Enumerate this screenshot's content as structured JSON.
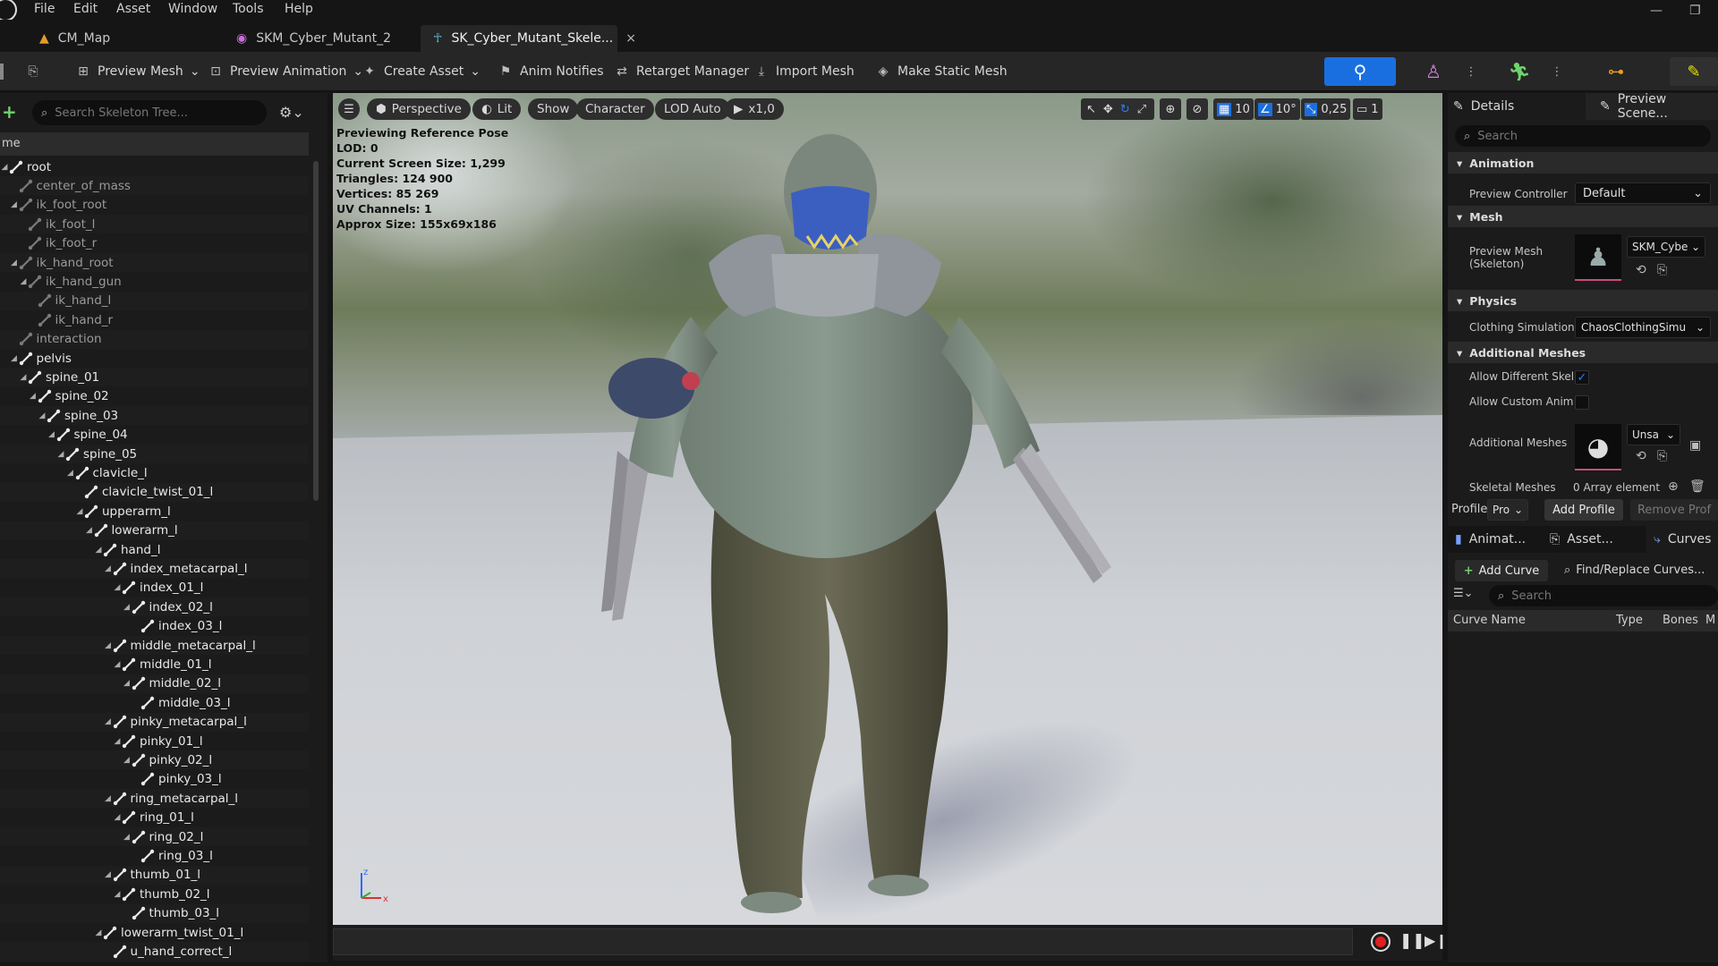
{
  "menu": [
    "File",
    "Edit",
    "Asset",
    "Window",
    "Tools",
    "Help"
  ],
  "tabs": [
    {
      "label": "CM_Map",
      "active": false,
      "icon": "level-icon"
    },
    {
      "label": "SKM_Cyber_Mutant_2",
      "active": false,
      "icon": "skeletal-mesh-icon"
    },
    {
      "label": "SK_Cyber_Mutant_Skele...",
      "active": true,
      "icon": "skeleton-icon",
      "close": "×"
    }
  ],
  "toolbar": {
    "preview_mesh": "Preview Mesh",
    "preview_animation": "Preview Animation",
    "create_asset": "Create Asset",
    "anim_notifies": "Anim Notifies",
    "retarget_manager": "Retarget Manager",
    "import_mesh": "Import Mesh",
    "make_static_mesh": "Make Static Mesh",
    "modes": [
      "skeleton-mode",
      "mesh-mode",
      "animation-mode",
      "physics-mode",
      "blueprint-mode"
    ]
  },
  "skeleton_tree": {
    "search_placeholder": "Search Skeleton Tree...",
    "column_header": "me",
    "bones": [
      {
        "name": "root",
        "depth": 0,
        "expanded": true,
        "virtual": false
      },
      {
        "name": "center_of_mass",
        "depth": 1,
        "virtual": true
      },
      {
        "name": "ik_foot_root",
        "depth": 1,
        "expanded": true,
        "virtual": true
      },
      {
        "name": "ik_foot_l",
        "depth": 2,
        "virtual": true
      },
      {
        "name": "ik_foot_r",
        "depth": 2,
        "virtual": true
      },
      {
        "name": "ik_hand_root",
        "depth": 1,
        "expanded": true,
        "virtual": true
      },
      {
        "name": "ik_hand_gun",
        "depth": 2,
        "expanded": true,
        "virtual": true
      },
      {
        "name": "ik_hand_l",
        "depth": 3,
        "virtual": true
      },
      {
        "name": "ik_hand_r",
        "depth": 3,
        "virtual": true
      },
      {
        "name": "interaction",
        "depth": 1,
        "virtual": true
      },
      {
        "name": "pelvis",
        "depth": 1,
        "expanded": true,
        "virtual": false
      },
      {
        "name": "spine_01",
        "depth": 2,
        "expanded": true,
        "virtual": false
      },
      {
        "name": "spine_02",
        "depth": 3,
        "expanded": true,
        "virtual": false
      },
      {
        "name": "spine_03",
        "depth": 4,
        "expanded": true,
        "virtual": false
      },
      {
        "name": "spine_04",
        "depth": 5,
        "expanded": true,
        "virtual": false
      },
      {
        "name": "spine_05",
        "depth": 6,
        "expanded": true,
        "virtual": false
      },
      {
        "name": "clavicle_l",
        "depth": 7,
        "expanded": true,
        "virtual": false
      },
      {
        "name": "clavicle_twist_01_l",
        "depth": 8,
        "virtual": false
      },
      {
        "name": "upperarm_l",
        "depth": 8,
        "expanded": true,
        "virtual": false
      },
      {
        "name": "lowerarm_l",
        "depth": 9,
        "expanded": true,
        "virtual": false
      },
      {
        "name": "hand_l",
        "depth": 10,
        "expanded": true,
        "virtual": false
      },
      {
        "name": "index_metacarpal_l",
        "depth": 11,
        "expanded": true,
        "virtual": false
      },
      {
        "name": "index_01_l",
        "depth": 12,
        "expanded": true,
        "virtual": false
      },
      {
        "name": "index_02_l",
        "depth": 13,
        "expanded": true,
        "virtual": false
      },
      {
        "name": "index_03_l",
        "depth": 14,
        "virtual": false
      },
      {
        "name": "middle_metacarpal_l",
        "depth": 11,
        "expanded": true,
        "virtual": false
      },
      {
        "name": "middle_01_l",
        "depth": 12,
        "expanded": true,
        "virtual": false
      },
      {
        "name": "middle_02_l",
        "depth": 13,
        "expanded": true,
        "virtual": false
      },
      {
        "name": "middle_03_l",
        "depth": 14,
        "virtual": false
      },
      {
        "name": "pinky_metacarpal_l",
        "depth": 11,
        "expanded": true,
        "virtual": false
      },
      {
        "name": "pinky_01_l",
        "depth": 12,
        "expanded": true,
        "virtual": false
      },
      {
        "name": "pinky_02_l",
        "depth": 13,
        "expanded": true,
        "virtual": false
      },
      {
        "name": "pinky_03_l",
        "depth": 14,
        "virtual": false
      },
      {
        "name": "ring_metacarpal_l",
        "depth": 11,
        "expanded": true,
        "virtual": false
      },
      {
        "name": "ring_01_l",
        "depth": 12,
        "expanded": true,
        "virtual": false
      },
      {
        "name": "ring_02_l",
        "depth": 13,
        "expanded": true,
        "virtual": false
      },
      {
        "name": "ring_03_l",
        "depth": 14,
        "virtual": false
      },
      {
        "name": "thumb_01_l",
        "depth": 11,
        "expanded": true,
        "virtual": false
      },
      {
        "name": "thumb_02_l",
        "depth": 12,
        "expanded": true,
        "virtual": false
      },
      {
        "name": "thumb_03_l",
        "depth": 13,
        "virtual": false
      },
      {
        "name": "lowerarm_twist_01_l",
        "depth": 10,
        "expanded": true,
        "virtual": false
      },
      {
        "name": "u_hand_correct_l",
        "depth": 11,
        "virtual": false
      }
    ]
  },
  "viewport": {
    "perspective": "Perspective",
    "lit": "Lit",
    "show": "Show",
    "character": "Character",
    "lod": "LOD Auto",
    "speed": "x1,0",
    "grid_snap": "10",
    "rotation_snap": "10°",
    "scale_snap": "0,25",
    "camera_speed": "1",
    "stats": [
      "Previewing Reference Pose",
      "LOD: 0",
      "Current Screen Size: 1,299",
      "Triangles: 124 900",
      "Vertices: 85 269",
      "UV Channels: 1",
      "Approx Size: 155x69x186"
    ]
  },
  "details": {
    "tab_details": "Details",
    "tab_preview": "Preview Scene...",
    "search_placeholder": "Search",
    "animation_category": "Animation",
    "preview_controller_label": "Preview Controller",
    "preview_controller_value": "Default",
    "mesh_category": "Mesh",
    "preview_mesh_label": "Preview Mesh (Skeleton)",
    "preview_mesh_value": "SKM_Cybe",
    "physics_category": "Physics",
    "clothing_sim_label": "Clothing Simulation",
    "clothing_sim_value": "ChaosClothingSimu",
    "additional_category": "Additional Meshes",
    "allow_diff_label": "Allow Different Skel",
    "allow_diff_checked": true,
    "allow_custom_label": "Allow Custom Anim",
    "allow_custom_checked": false,
    "additional_meshes_label": "Additional Meshes",
    "additional_meshes_value": "Unsa",
    "skeletal_meshes_label": "Skeletal Meshes",
    "skeletal_meshes_value": "0 Array element",
    "profile_label": "Profile",
    "profile_value": "Pro",
    "add_profile": "Add Profile",
    "remove_profile": "Remove Prof"
  },
  "curves": {
    "tab_anim": "Animat...",
    "tab_asset": "Asset...",
    "tab_curves": "Curves",
    "add_curve": "Add Curve",
    "find_replace": "Find/Replace Curves...",
    "search_placeholder": "Search",
    "columns": [
      "Curve Name",
      "Type",
      "Bones",
      "M"
    ]
  },
  "colors": {
    "accent": "#1a6fe0",
    "panel": "#1b1b1b",
    "toolbar": "#262626",
    "thumb_underline": "#c84b7e"
  }
}
